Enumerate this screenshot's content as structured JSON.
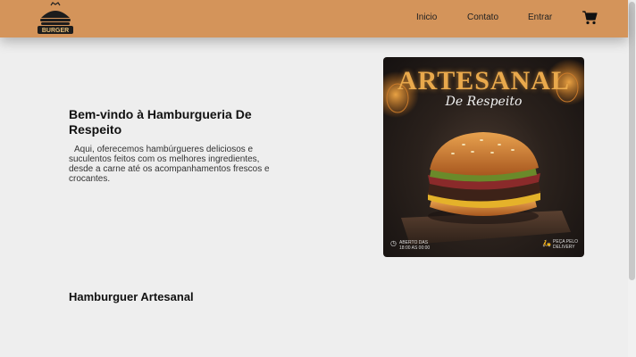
{
  "header": {
    "logo_text": "BURGER",
    "nav": [
      {
        "label": "Inicio"
      },
      {
        "label": "Contato"
      },
      {
        "label": "Entrar"
      }
    ],
    "cart_icon": "shopping-cart-icon",
    "background_color": "#d4945a"
  },
  "hero": {
    "title": "Bem-vindo à Hamburgueria De Respeito",
    "text": "Aqui, oferecemos hambúrgueres deliciosos e suculentos feitos com os melhores ingredientes, desde a carne até os acompanhamentos frescos e crocantes."
  },
  "promo": {
    "title": "ARTESANAL",
    "script": "De Respeito",
    "hours_line1": "ABERTO DAS",
    "hours_line2": "18:00 AS 00:00",
    "delivery_line1": "PEÇA PELO",
    "delivery_line2": "DELIVERY"
  },
  "section": {
    "title": "Hamburguer Artesanal"
  }
}
